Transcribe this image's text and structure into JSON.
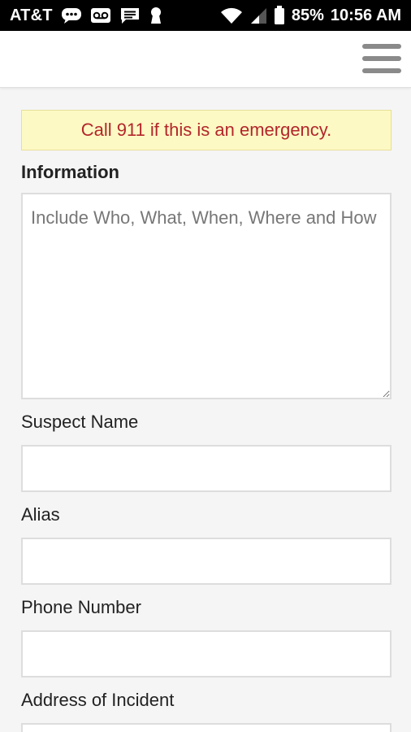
{
  "status_bar": {
    "carrier": "AT&T",
    "icons": [
      "chat-bubble-icon",
      "voicemail-icon",
      "message-icon",
      "keyhole-icon",
      "wifi-icon",
      "signal-icon",
      "battery-icon"
    ],
    "battery": "85%",
    "time": "10:56 AM"
  },
  "header": {
    "menu_icon": "hamburger-menu-icon"
  },
  "form": {
    "emergency_notice": "Call 911 if this is an emergency.",
    "information_label": "Information",
    "information_placeholder": "Include Who, What, When, Where and How",
    "suspect_name_label": "Suspect Name",
    "alias_label": "Alias",
    "phone_number_label": "Phone Number",
    "address_label": "Address of Incident"
  },
  "colors": {
    "banner_bg": "#fdf9c4",
    "banner_text": "#b3262b",
    "page_bg": "#f5f5f5",
    "input_border": "#dddddd"
  }
}
